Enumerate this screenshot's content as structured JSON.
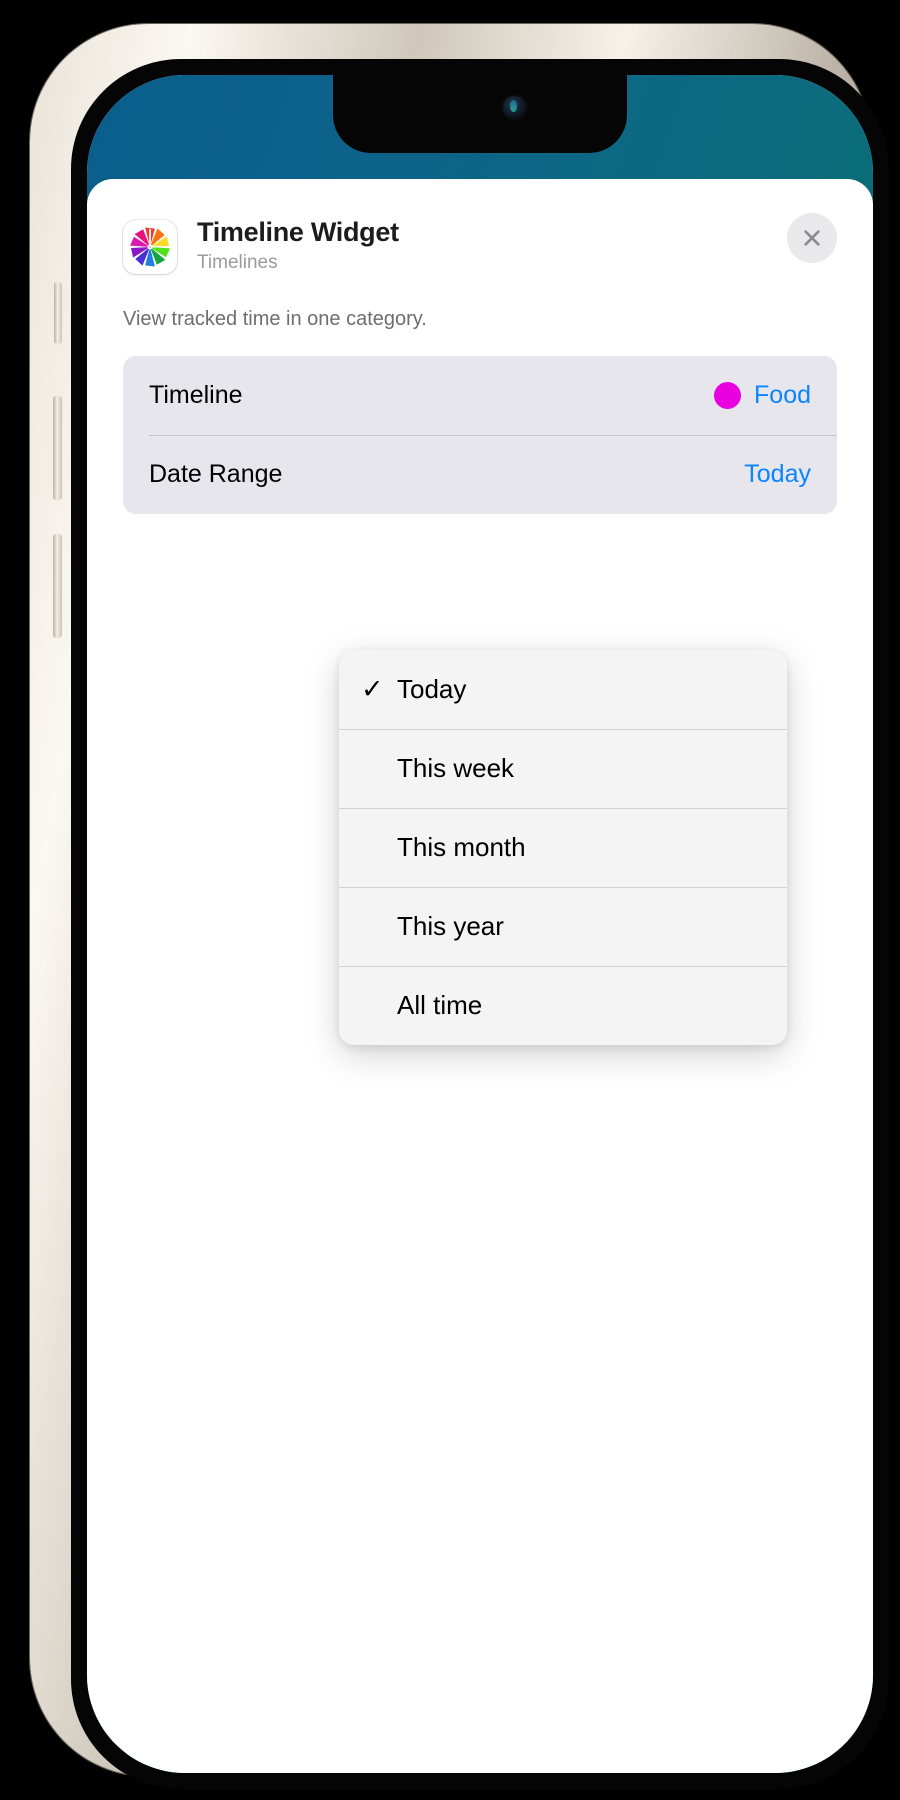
{
  "device": {
    "frame_color": "#e4ded3",
    "wallpaper_gradient_from": "#0a5e8c",
    "wallpaper_gradient_to": "#0d6a60"
  },
  "modal": {
    "app_icon": "timelines-pinwheel-icon",
    "title": "Timeline Widget",
    "subtitle": "Timelines",
    "close_label": "×",
    "description": "View tracked time in one category.",
    "rows": [
      {
        "label": "Timeline",
        "value": "Food",
        "dot_color": "#e800e0",
        "has_dot": true
      },
      {
        "label": "Date Range",
        "value": "Today",
        "has_dot": false
      }
    ]
  },
  "dropdown": {
    "open_for": "Date Range",
    "selected": "Today",
    "check_glyph": "✓",
    "items": [
      {
        "label": "Today",
        "checked": true
      },
      {
        "label": "This week",
        "checked": false
      },
      {
        "label": "This month",
        "checked": false
      },
      {
        "label": "This year",
        "checked": false
      },
      {
        "label": "All time",
        "checked": false
      }
    ]
  },
  "colors": {
    "accent_blue": "#0a84ff",
    "card_bg": "#e6e6ec",
    "menu_bg": "#f4f4f4",
    "subtitle_gray": "#9a9a9f",
    "description_gray": "#6d6d72"
  }
}
